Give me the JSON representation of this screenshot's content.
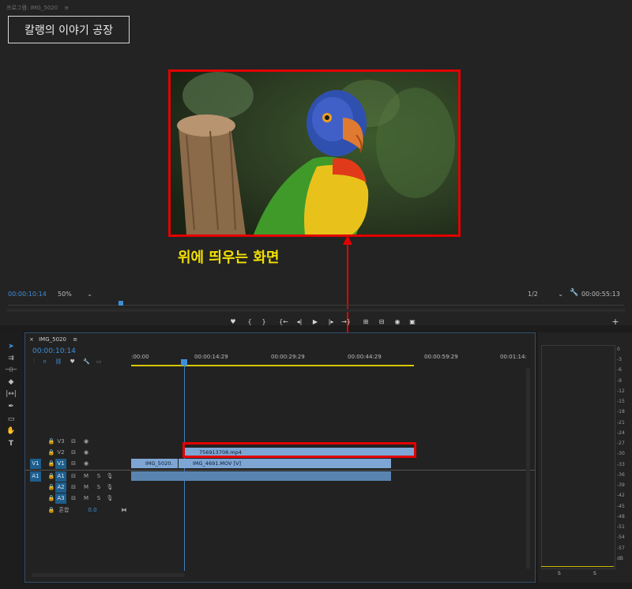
{
  "monitor": {
    "title": "프로그램: IMG_5020",
    "title_menu": "≡",
    "watermark_text": "칼랭의 이야기 공장",
    "annotation_text": "위에 띄우는 화면",
    "playhead_timecode": "00:00:10:14",
    "zoom_level": "50%",
    "resolution": "1/2",
    "duration_timecode": "00:00:55:13"
  },
  "transport": {
    "marker": "♥",
    "in_point": "{",
    "out_point": "}",
    "goto_in": "{←",
    "step_back": "◂|",
    "play": "▶",
    "step_forward": "|▸",
    "goto_out": "→}",
    "insert": "⊞",
    "overwrite": "⊟",
    "export_frame": "◉",
    "compare": "▣",
    "add": "+"
  },
  "timeline": {
    "sequence_name": "IMG_5020",
    "menu": "≡",
    "playhead_timecode": "00:00:10:14",
    "ruler_labels": [
      ":00:00",
      "00:00:14:29",
      "00:00:29:29",
      "00:00:44:29",
      "00:00:59:29",
      "00:01:14:"
    ],
    "video_tracks": [
      {
        "source": "",
        "name": "V3"
      },
      {
        "source": "",
        "name": "V2"
      },
      {
        "source": "V1",
        "name": "V1"
      }
    ],
    "audio_tracks": [
      {
        "source": "A1",
        "name": "A1",
        "m": "M",
        "s": "S"
      },
      {
        "source": "",
        "name": "A2",
        "m": "M",
        "s": "S"
      },
      {
        "source": "",
        "name": "A3",
        "m": "M",
        "s": "S"
      }
    ],
    "master": {
      "label": "혼합",
      "value": "0.0"
    },
    "clips": {
      "v2_clip": "756913708.mp4",
      "v1_clip_a": "IMG_5020.",
      "v1_clip_b": "IMG_4691.MOV [V]"
    }
  },
  "meter": {
    "db_labels": [
      "0",
      "-3",
      "-6",
      "-9",
      "-12",
      "-15",
      "-18",
      "-21",
      "-24",
      "-27",
      "-30",
      "-33",
      "-36",
      "-39",
      "-42",
      "-45",
      "-48",
      "-51",
      "-54",
      "-57",
      "dB"
    ],
    "solo_left": "S",
    "solo_right": "S"
  },
  "colors": {
    "annotation_red": "#e30000",
    "annotation_yellow": "#f2e000",
    "accent_blue": "#3f8fd8",
    "clip_blue": "#7ea6d4"
  }
}
